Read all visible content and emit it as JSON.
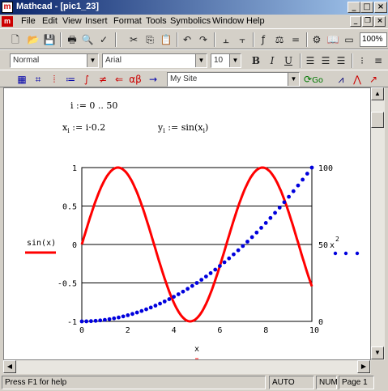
{
  "window": {
    "app_icon": "m",
    "title": "Mathcad - [pic1_23]"
  },
  "menu": {
    "doc_icon": "m",
    "items": [
      "File",
      "Edit",
      "View",
      "Insert",
      "Format",
      "Tools",
      "Symbolics",
      "Window",
      "Help"
    ]
  },
  "toolbar": {
    "zoom": "100%"
  },
  "format_bar": {
    "style": "Normal",
    "font": "Arial",
    "size": "10",
    "bold": "B",
    "italic": "I",
    "underline": "U"
  },
  "math_bar": {
    "resource": "My Site",
    "go": "Go"
  },
  "worksheet": {
    "range_def": "i := 0 .. 50",
    "x_def": {
      "var": "x",
      "sub": "i",
      "expr": ":= i·0.2"
    },
    "y_def": {
      "var": "y",
      "sub": "i",
      "expr": ":= sin(x",
      "expr_sub": "i",
      "expr_end": ")"
    }
  },
  "chart_data": {
    "type": "line",
    "xlabel": "x",
    "left_axis_label": "sin(x)",
    "right_axis_label": "x",
    "right_axis_exp": "2",
    "x_ticks": [
      "0",
      "2",
      "4",
      "6",
      "8",
      "10"
    ],
    "left_ticks": [
      "1",
      "0.5",
      "0",
      "-0.5",
      "-1"
    ],
    "right_ticks": [
      "100",
      "50",
      "0"
    ],
    "xlim": [
      0,
      10
    ],
    "ylim_left": [
      -1,
      1
    ],
    "ylim_right": [
      0,
      100
    ],
    "grid": "horizontal",
    "series": [
      {
        "axis": "left",
        "style": "solid-line",
        "color": "#ff0000",
        "fn": "sin"
      },
      {
        "axis": "right",
        "style": "dots",
        "color": "#0000dd",
        "fn": "square"
      }
    ],
    "x_values": [
      0,
      0.2,
      0.4,
      0.6,
      0.8,
      1,
      1.2,
      1.4,
      1.6,
      1.8,
      2,
      2.2,
      2.4,
      2.6,
      2.8,
      3,
      3.2,
      3.4,
      3.6,
      3.8,
      4,
      4.2,
      4.4,
      4.6,
      4.8,
      5,
      5.2,
      5.4,
      5.6,
      5.8,
      6,
      6.2,
      6.4,
      6.6,
      6.8,
      7,
      7.2,
      7.4,
      7.6,
      7.8,
      8,
      8.2,
      8.4,
      8.6,
      8.8,
      9,
      9.2,
      9.4,
      9.6,
      9.8,
      10
    ]
  },
  "status": {
    "hint": "Press F1 for help",
    "mode": "AUTO",
    "num": "NUM",
    "page": "Page 1"
  },
  "colors": {
    "titlebar": "#0a246a",
    "sin_trace": "#ff0000",
    "square_trace": "#0000dd"
  }
}
